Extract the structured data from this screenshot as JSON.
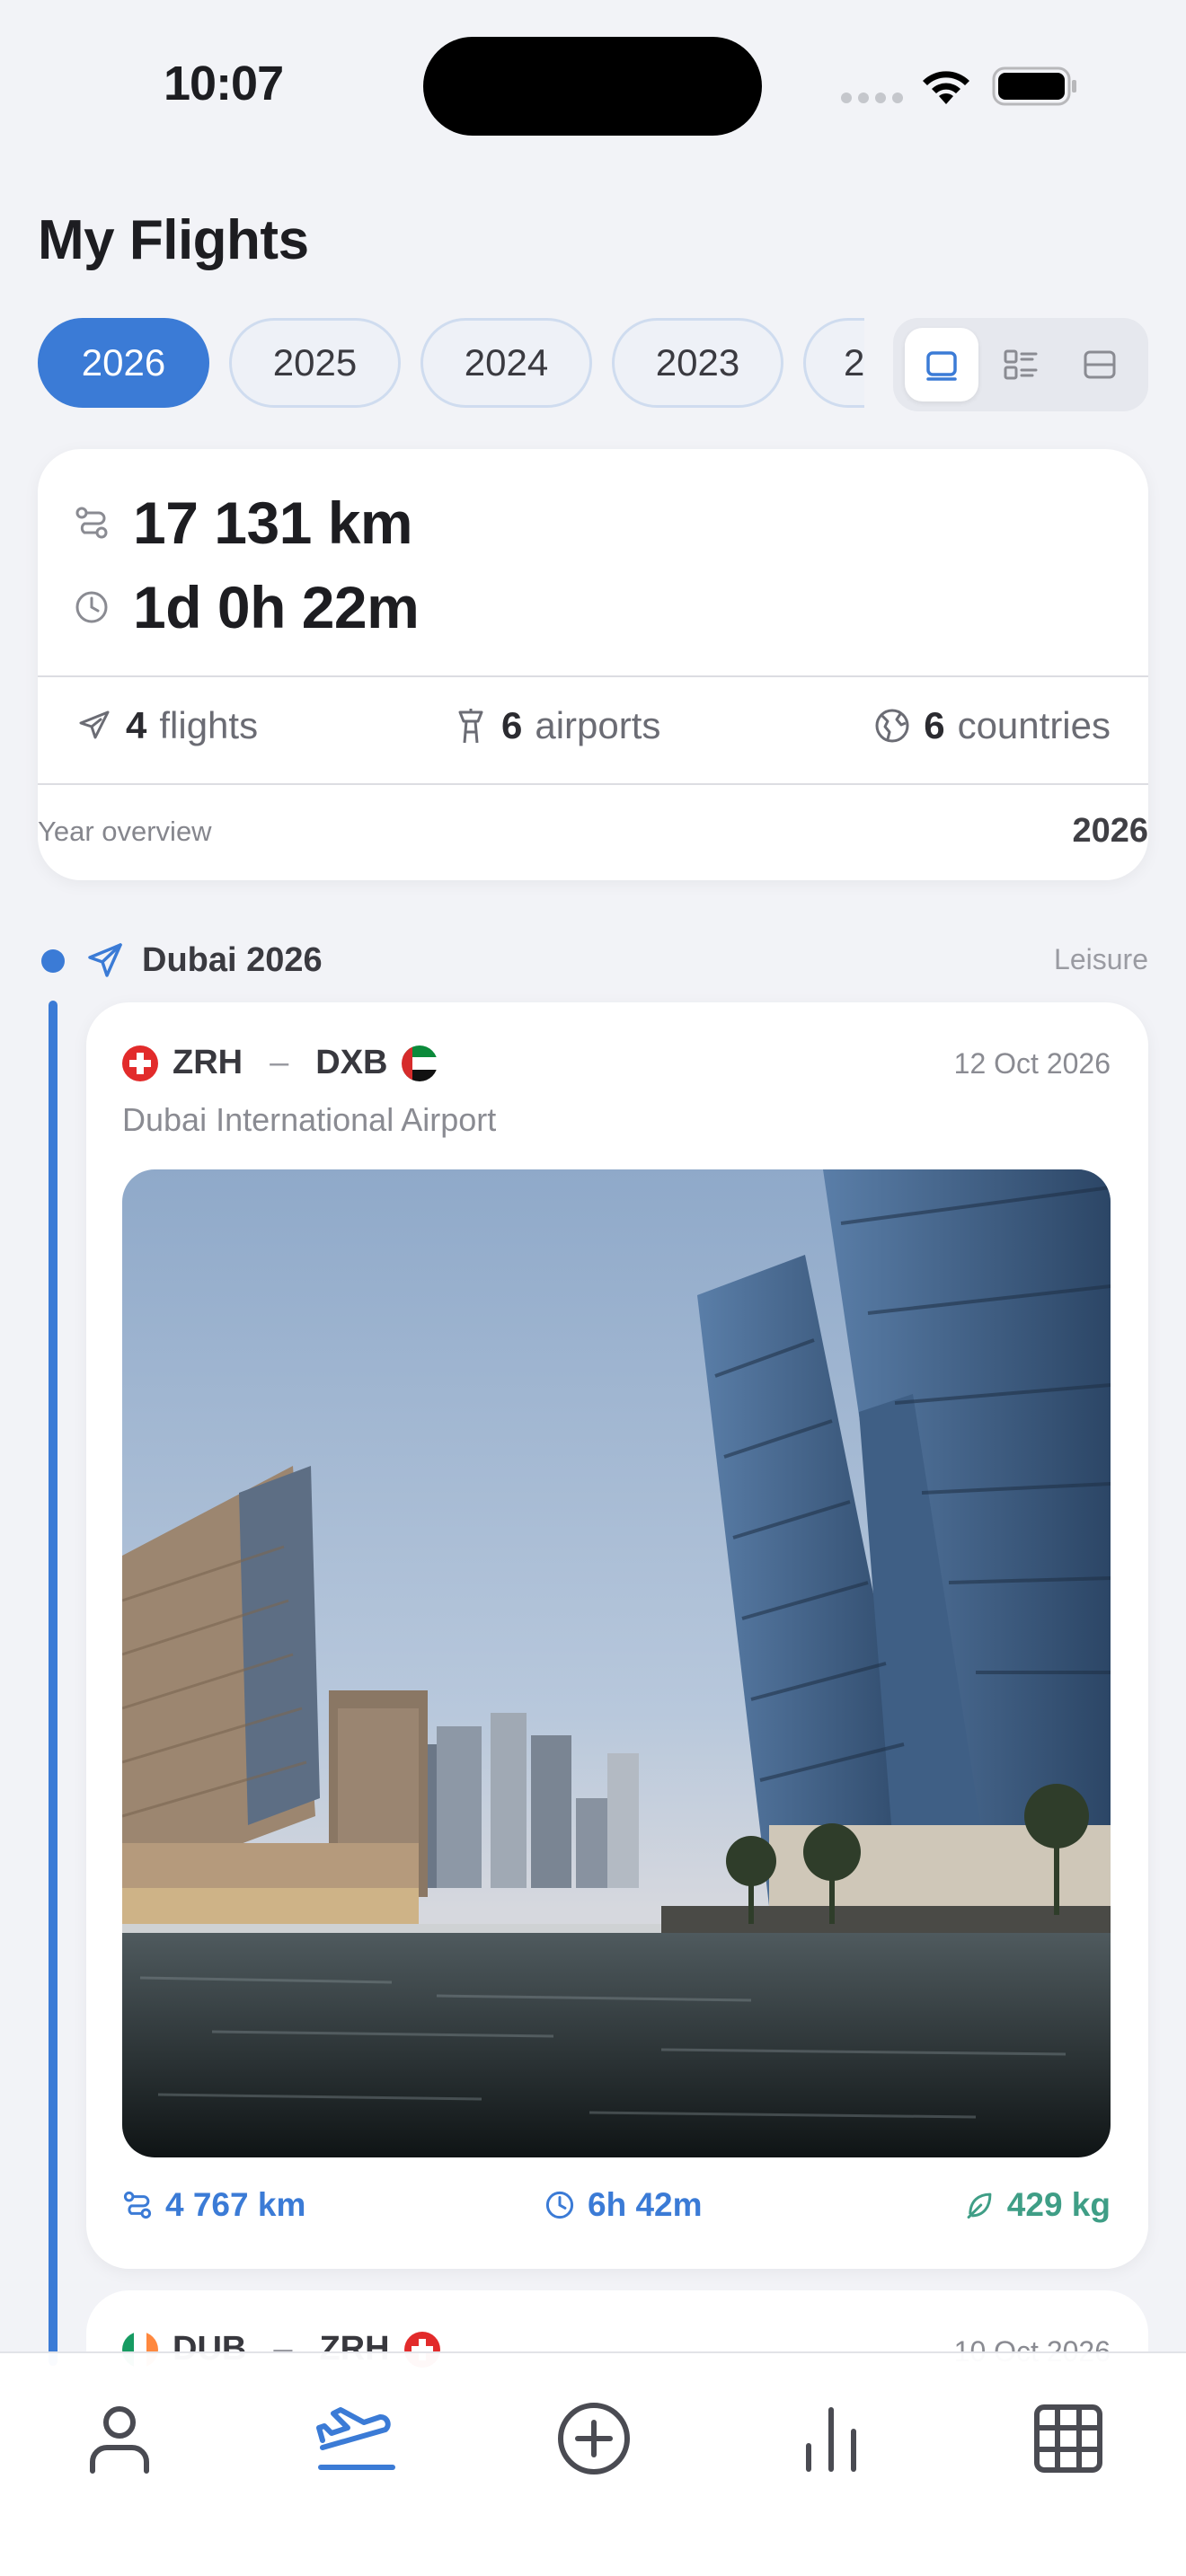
{
  "status_bar": {
    "time": "10:07"
  },
  "page_title": "My Flights",
  "years": [
    "2026",
    "2025",
    "2024",
    "2023",
    "2"
  ],
  "selected_year": "2026",
  "view_modes": [
    "cards-view-icon",
    "list-view-icon",
    "compact-view-icon"
  ],
  "summary": {
    "distance": "17 131 km",
    "duration": "1d 0h 22m",
    "flights_count": "4",
    "flights_label": "flights",
    "airports_count": "6",
    "airports_label": "airports",
    "countries_count": "6",
    "countries_label": "countries",
    "overview_label": "Year overview",
    "overview_year": "2026"
  },
  "trip": {
    "name": "Dubai 2026",
    "type": "Leisure"
  },
  "flight": {
    "from": "ZRH",
    "dash": "–",
    "to": "DXB",
    "date": "12 Oct 2026",
    "airport": "Dubai International Airport",
    "distance": "4 767 km",
    "duration": "6h 42m",
    "co2": "429 kg"
  },
  "next_flight": {
    "from": "DUB",
    "dash": "–",
    "to": "ZRH",
    "date": "10 Oct 2026"
  },
  "tabs": [
    "profile-icon",
    "flights-icon",
    "add-icon",
    "stats-icon",
    "grid-icon"
  ],
  "colors": {
    "accent": "#3b7bd6",
    "co2_green": "#3f9e86",
    "background": "#f2f3f7"
  }
}
